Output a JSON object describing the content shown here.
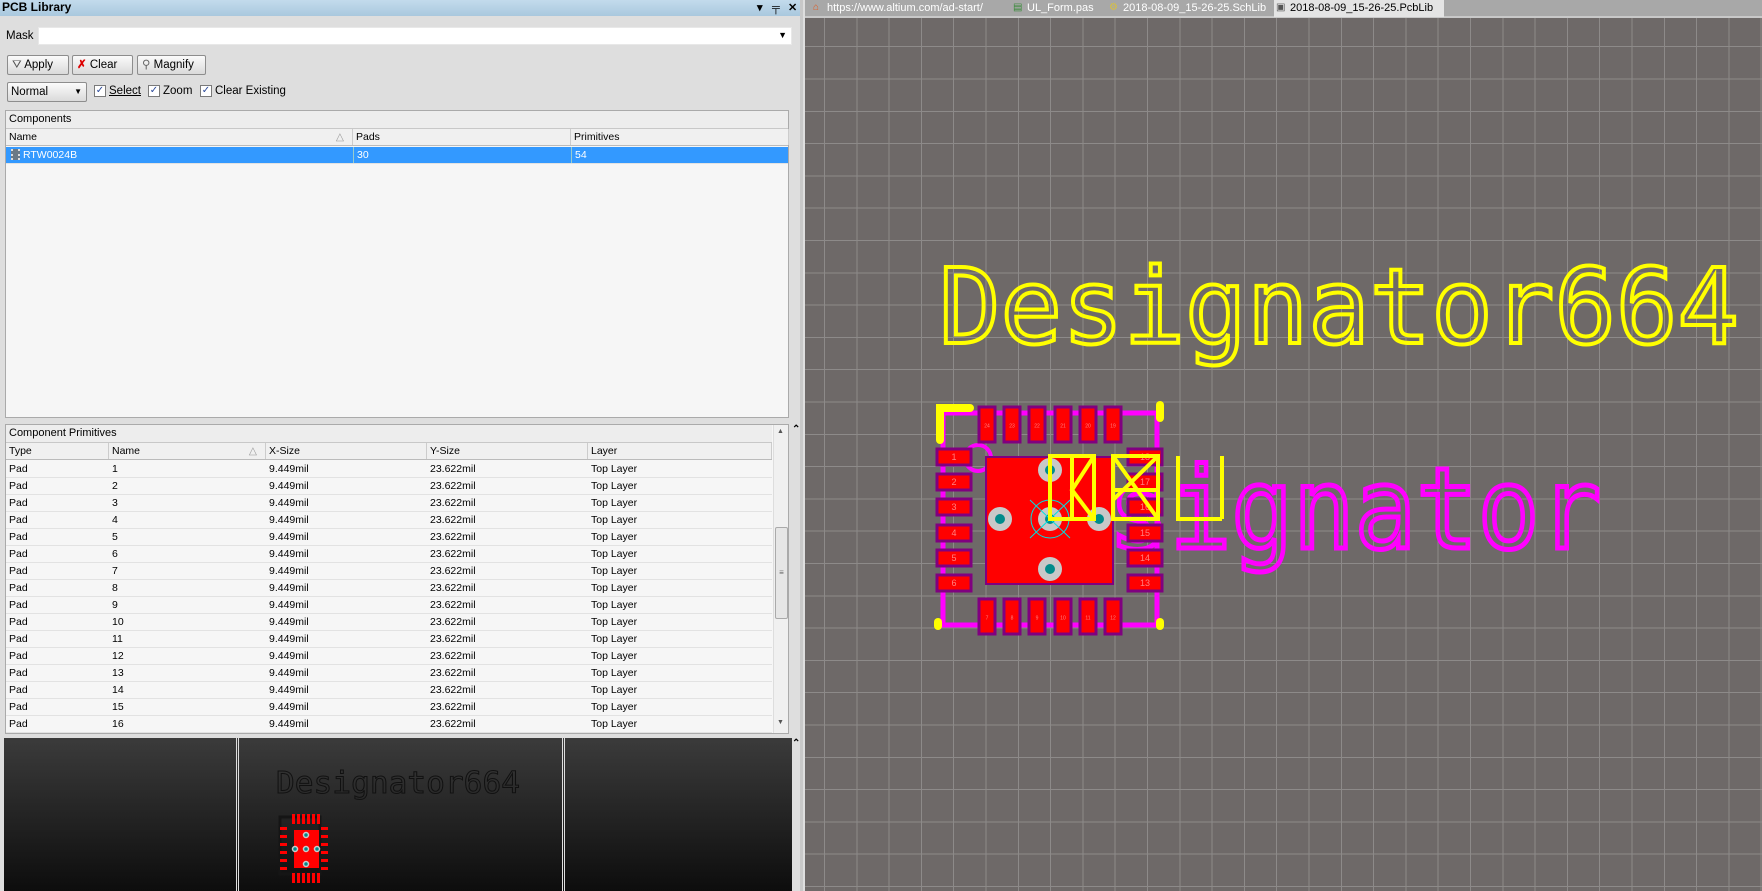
{
  "panel": {
    "title": "PCB Library",
    "title_icons": [
      "dropdown-icon",
      "pin-icon",
      "close-icon"
    ],
    "mask_label": "Mask",
    "mask_value": "",
    "buttons": {
      "apply": "Apply",
      "clear": "Clear",
      "magnify": "Magnify"
    },
    "mode_select": "Normal",
    "checkboxes": [
      {
        "label": "Select",
        "checked": true
      },
      {
        "label": "Zoom",
        "checked": true
      },
      {
        "label": "Clear Existing",
        "checked": true
      }
    ]
  },
  "components": {
    "title": "Components",
    "columns": [
      "Name",
      "Pads",
      "Primitives"
    ],
    "rows": [
      {
        "name": "RTW0024B",
        "pads": "30",
        "primitives": "54",
        "selected": true
      }
    ]
  },
  "primitives": {
    "title": "Component Primitives",
    "columns": [
      "Type",
      "Name",
      "X-Size",
      "Y-Size",
      "Layer"
    ],
    "rows": [
      [
        "Pad",
        "1",
        "9.449mil",
        "23.622mil",
        "Top Layer"
      ],
      [
        "Pad",
        "2",
        "9.449mil",
        "23.622mil",
        "Top Layer"
      ],
      [
        "Pad",
        "3",
        "9.449mil",
        "23.622mil",
        "Top Layer"
      ],
      [
        "Pad",
        "4",
        "9.449mil",
        "23.622mil",
        "Top Layer"
      ],
      [
        "Pad",
        "5",
        "9.449mil",
        "23.622mil",
        "Top Layer"
      ],
      [
        "Pad",
        "6",
        "9.449mil",
        "23.622mil",
        "Top Layer"
      ],
      [
        "Pad",
        "7",
        "9.449mil",
        "23.622mil",
        "Top Layer"
      ],
      [
        "Pad",
        "8",
        "9.449mil",
        "23.622mil",
        "Top Layer"
      ],
      [
        "Pad",
        "9",
        "9.449mil",
        "23.622mil",
        "Top Layer"
      ],
      [
        "Pad",
        "10",
        "9.449mil",
        "23.622mil",
        "Top Layer"
      ],
      [
        "Pad",
        "11",
        "9.449mil",
        "23.622mil",
        "Top Layer"
      ],
      [
        "Pad",
        "12",
        "9.449mil",
        "23.622mil",
        "Top Layer"
      ],
      [
        "Pad",
        "13",
        "9.449mil",
        "23.622mil",
        "Top Layer"
      ],
      [
        "Pad",
        "14",
        "9.449mil",
        "23.622mil",
        "Top Layer"
      ],
      [
        "Pad",
        "15",
        "9.449mil",
        "23.622mil",
        "Top Layer"
      ],
      [
        "Pad",
        "16",
        "9.449mil",
        "23.622mil",
        "Top Layer"
      ]
    ]
  },
  "tabs": [
    {
      "label": "https://www.altium.com/ad-start/",
      "icon": "home-icon",
      "active": false
    },
    {
      "label": "UL_Form.pas",
      "icon": "script-file-icon",
      "active": false
    },
    {
      "label": "2018-08-09_15-26-25.SchLib",
      "icon": "schlib-icon",
      "active": false
    },
    {
      "label": "2018-08-09_15-26-25.PcbLib",
      "icon": "pcblib-icon",
      "active": true
    }
  ],
  "canvas": {
    "designator_text": "Designator664",
    "overlay_text": "Designator",
    "pads_top": [
      "24",
      "23",
      "22",
      "21",
      "20",
      "19"
    ],
    "pads_bottom": [
      "7",
      "8",
      "9",
      "10",
      "11",
      "12"
    ],
    "pads_left": [
      "1",
      "2",
      "3",
      "4",
      "5",
      "6"
    ],
    "pads_right": [
      "18",
      "17",
      "16",
      "15",
      "14",
      "13"
    ],
    "colors": {
      "top_layer": "#ff0000",
      "overlay": "#ffff00",
      "mechanical": "#ff00ff",
      "pad_border": "#800080",
      "via": "#008b8b",
      "grid_bg": "#6e6968"
    }
  }
}
